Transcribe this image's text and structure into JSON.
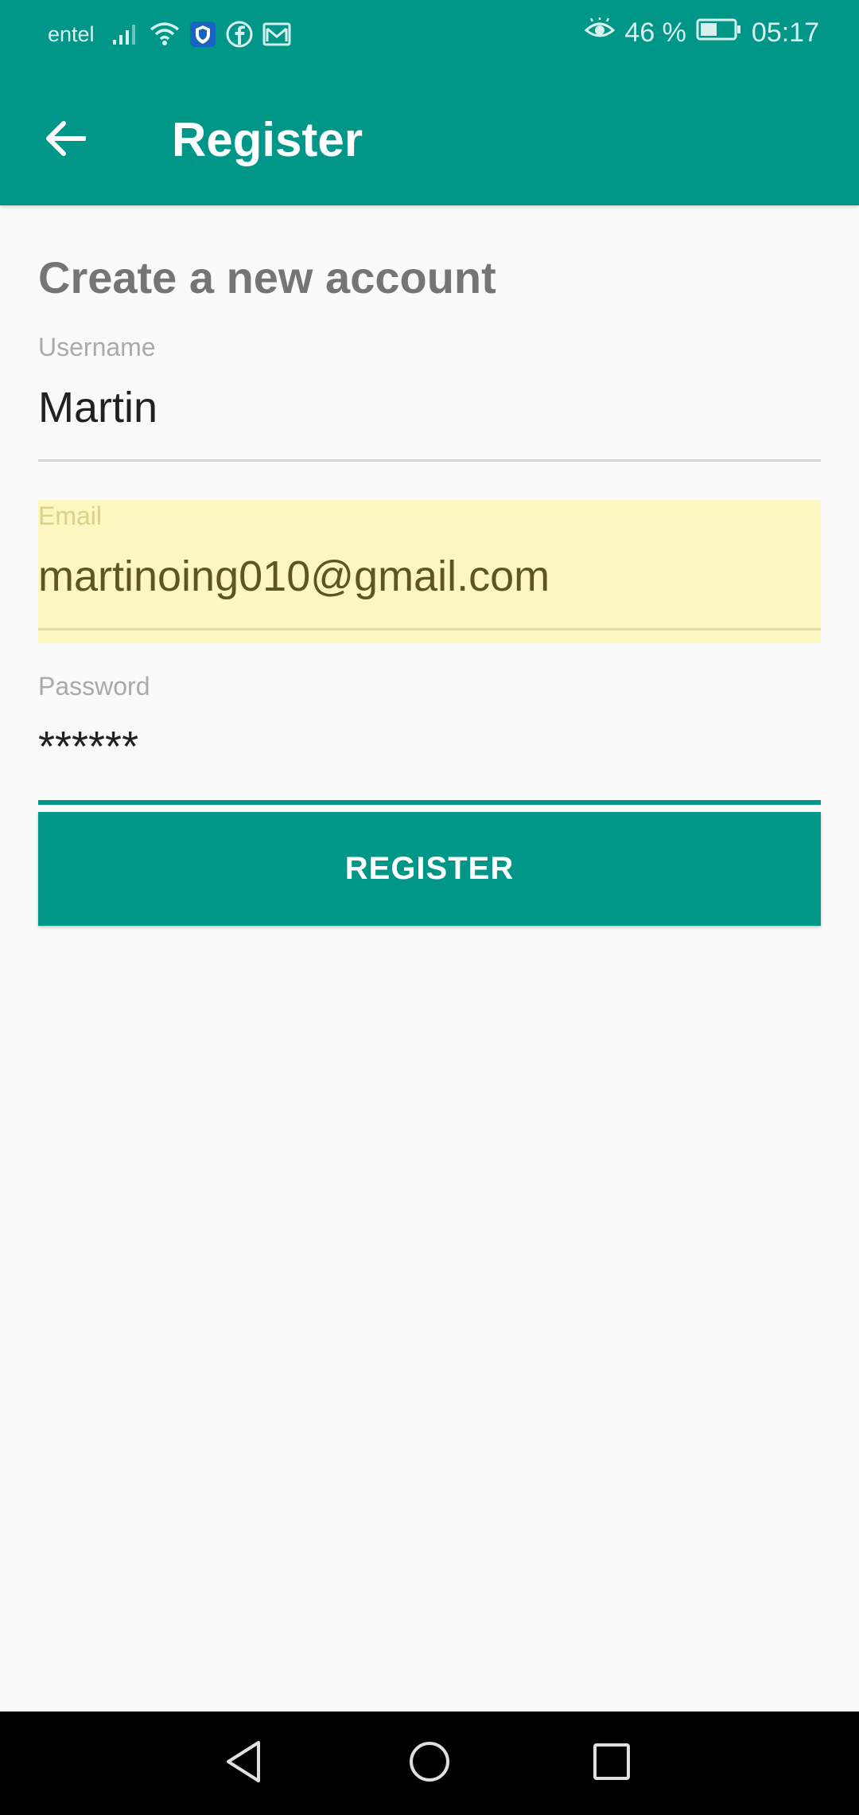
{
  "status_bar": {
    "carrier": "entel",
    "battery": "46 %",
    "time": "05:17"
  },
  "app_bar": {
    "title": "Register"
  },
  "form": {
    "heading": "Create a new account",
    "username": {
      "label": "Username",
      "value": "Martin"
    },
    "email": {
      "label": "Email",
      "value": "martinoing010@gmail.com"
    },
    "password": {
      "label": "Password",
      "value": "******"
    },
    "submit_label": "REGISTER"
  },
  "colors": {
    "primary": "#009688",
    "autofill_highlight": "#FCF6C0"
  }
}
